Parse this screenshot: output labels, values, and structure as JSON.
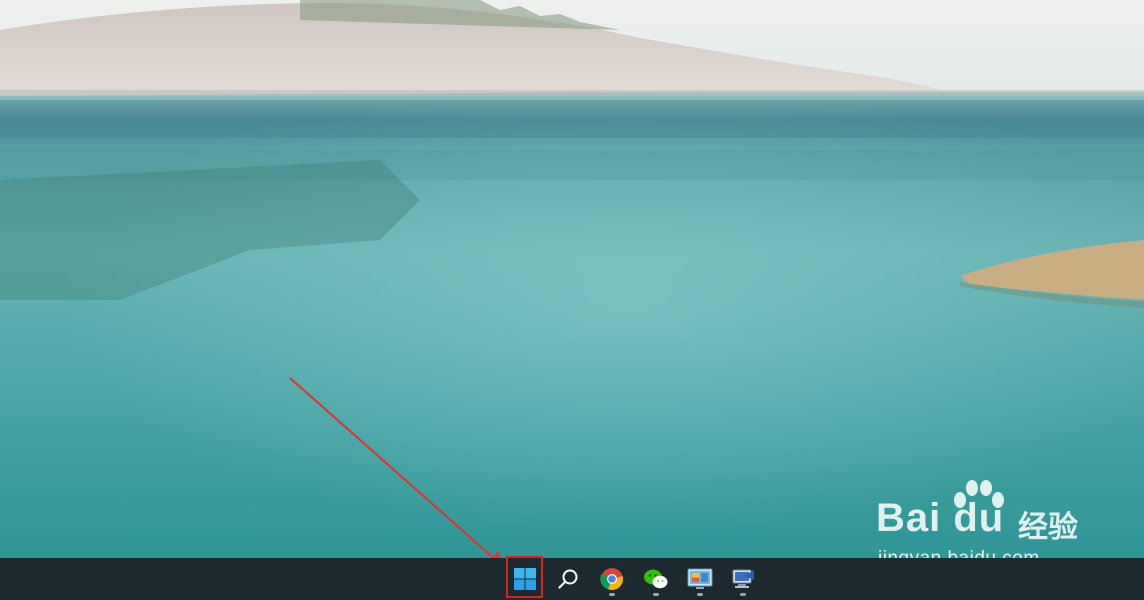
{
  "wallpaper": {
    "sky_color": "#e6ecea",
    "water_color": "#3fa3a5",
    "rock_color": "#d9d2cc",
    "grass_color": "#c7ad82"
  },
  "taskbar": {
    "background": "#1c2a30",
    "items": [
      {
        "name": "start",
        "icon": "windows-logo-icon",
        "running": false,
        "highlighted": true
      },
      {
        "name": "search",
        "icon": "search-icon",
        "running": false
      },
      {
        "name": "chrome",
        "icon": "chrome-icon",
        "running": true
      },
      {
        "name": "wechat",
        "icon": "wechat-icon",
        "running": true
      },
      {
        "name": "control-panel",
        "icon": "control-panel-icon",
        "running": true
      },
      {
        "name": "remote-desktop",
        "icon": "remote-desktop-icon",
        "running": true
      }
    ]
  },
  "annotation": {
    "highlight_color": "#e02020",
    "arrow_target": "start-button"
  },
  "watermark": {
    "logo_text": "Bai du",
    "chinese_text": "经验",
    "url_text": "jingyan.baidu.com"
  }
}
